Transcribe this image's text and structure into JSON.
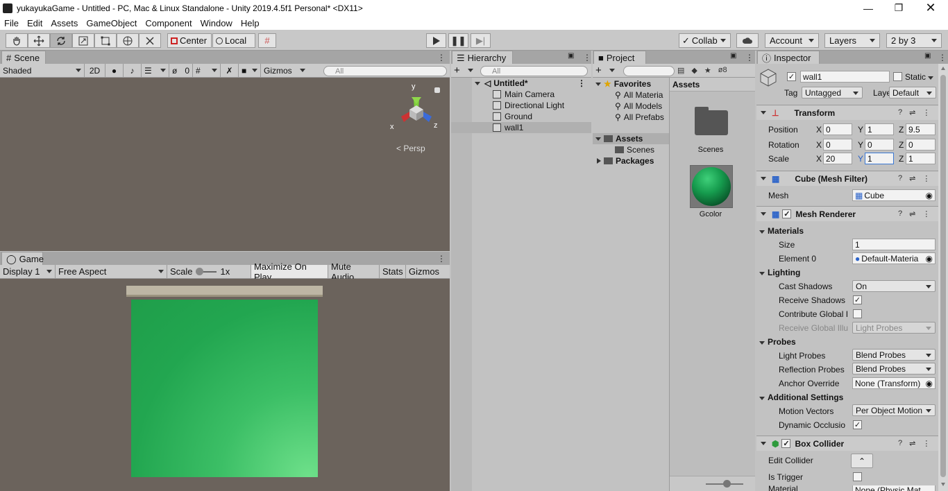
{
  "titlebar": {
    "title": "yukayukaGame - Untitled - PC, Mac & Linux Standalone - Unity 2019.4.5f1 Personal* <DX11>"
  },
  "menu": [
    "File",
    "Edit",
    "Assets",
    "GameObject",
    "Component",
    "Window",
    "Help"
  ],
  "toolbar": {
    "center": "Center",
    "local": "Local",
    "collab": "Collab",
    "account": "Account",
    "layers": "Layers",
    "layout": "2 by 3"
  },
  "scene": {
    "tab": "Scene",
    "shading": "Shaded",
    "mode2d": "2D",
    "hidden_count": "0",
    "gizmos": "Gizmos",
    "search_placeholder": "All",
    "persp": "Persp",
    "axis_x": "x",
    "axis_y": "y",
    "axis_z": "z",
    "background": "#6b635c"
  },
  "game": {
    "tab": "Game",
    "display": "Display 1",
    "aspect": "Free Aspect",
    "scale_label": "Scale",
    "scale_value": "1x",
    "maximize": "Maximize On Play",
    "mute": "Mute Audio",
    "stats": "Stats",
    "gizmos": "Gizmos",
    "wall_color": "#22a650",
    "ground_color": "#bdb6a4"
  },
  "hierarchy": {
    "tab": "Hierarchy",
    "search_placeholder": "All",
    "scene_name": "Untitled*",
    "items": [
      "Main Camera",
      "Directional Light",
      "Ground",
      "wall1"
    ]
  },
  "project": {
    "tab": "Project",
    "hidden_count": "8",
    "favorites": {
      "label": "Favorites",
      "items": [
        "All Materia",
        "All Models",
        "All Prefabs"
      ]
    },
    "assets": {
      "label": "Assets",
      "children": [
        "Scenes"
      ]
    },
    "packages": "Packages",
    "grid_title": "Assets",
    "grid_items": [
      {
        "name": "Scenes",
        "kind": "folder"
      },
      {
        "name": "Gcolor",
        "kind": "material"
      }
    ]
  },
  "inspector": {
    "tab": "Inspector",
    "object_name": "wall1",
    "static_label": "Static",
    "tag_label": "Tag",
    "tag_value": "Untagged",
    "layer_label": "Layer",
    "layer_value": "Default",
    "transform": {
      "title": "Transform",
      "position_label": "Position",
      "position": {
        "x": "0",
        "y": "1",
        "z": "9.5"
      },
      "rotation_label": "Rotation",
      "rotation": {
        "x": "0",
        "y": "0",
        "z": "0"
      },
      "scale_label": "Scale",
      "scale": {
        "x": "20",
        "y": "1",
        "z": "1"
      },
      "x": "X",
      "y": "Y",
      "z": "Z"
    },
    "mesh_filter": {
      "title": "Cube (Mesh Filter)",
      "mesh_label": "Mesh",
      "mesh_value": "Cube"
    },
    "mesh_renderer": {
      "title": "Mesh Renderer",
      "materials": "Materials",
      "size_label": "Size",
      "size_value": "1",
      "element0_label": "Element 0",
      "element0_value": "Default-Materia",
      "lighting": "Lighting",
      "cast_shadows_label": "Cast Shadows",
      "cast_shadows_value": "On",
      "receive_shadows_label": "Receive Shadows",
      "contribute_gi_label": "Contribute Global I",
      "receive_gi_label": "Receive Global Illu",
      "receive_gi_value": "Light Probes",
      "probes": "Probes",
      "light_probes_label": "Light Probes",
      "light_probes_value": "Blend Probes",
      "reflection_probes_label": "Reflection Probes",
      "reflection_probes_value": "Blend Probes",
      "anchor_override_label": "Anchor Override",
      "anchor_override_value": "None (Transform)",
      "additional": "Additional Settings",
      "motion_vectors_label": "Motion Vectors",
      "motion_vectors_value": "Per Object Motion",
      "dynamic_occlusion_label": "Dynamic Occlusio"
    },
    "box_collider": {
      "title": "Box Collider",
      "edit_collider_label": "Edit Collider",
      "is_trigger_label": "Is Trigger",
      "material_label": "Material",
      "material_value": "None (Physic Mat"
    }
  }
}
